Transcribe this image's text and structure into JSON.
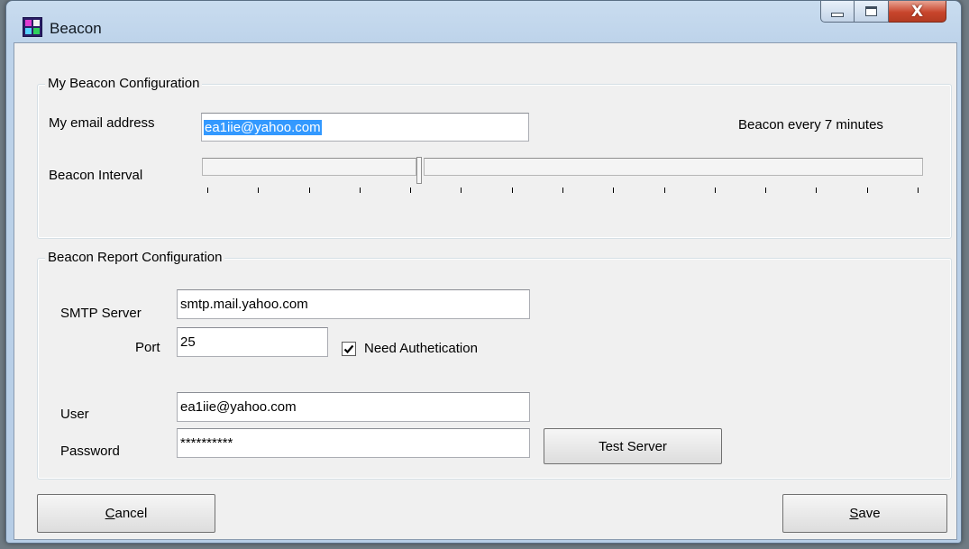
{
  "window": {
    "title": "Beacon"
  },
  "titlebar": {
    "min_icon": "minimize-icon",
    "max_icon": "maximize-icon",
    "close_icon": "close-icon",
    "close_glyph": "X"
  },
  "beacon_config": {
    "legend": "My Beacon Configuration",
    "email_label": "My email address",
    "email_value": "ea1iie@yahoo.com",
    "interval_text": "Beacon every 7 minutes",
    "interval_label": "Beacon Interval",
    "interval_level": 0.3
  },
  "report_config": {
    "legend": "Beacon Report Configuration",
    "smtp_label": "SMTP Server",
    "smtp_value": "smtp.mail.yahoo.com",
    "port_label": "Port",
    "port_value": "25",
    "auth_label": "Need Authetication",
    "auth_checked": true,
    "user_label": "User",
    "user_value": "ea1iie@yahoo.com",
    "password_label": "Password",
    "password_value": "**********",
    "test_button": "Test Server"
  },
  "buttons": {
    "cancel_accel": "C",
    "cancel_rest": "ancel",
    "save_accel": "S",
    "save_rest": "ave"
  },
  "colors": {
    "selection": "#3399ff",
    "close_button": "#c8452c",
    "window_frame": "#bdd3ea"
  }
}
